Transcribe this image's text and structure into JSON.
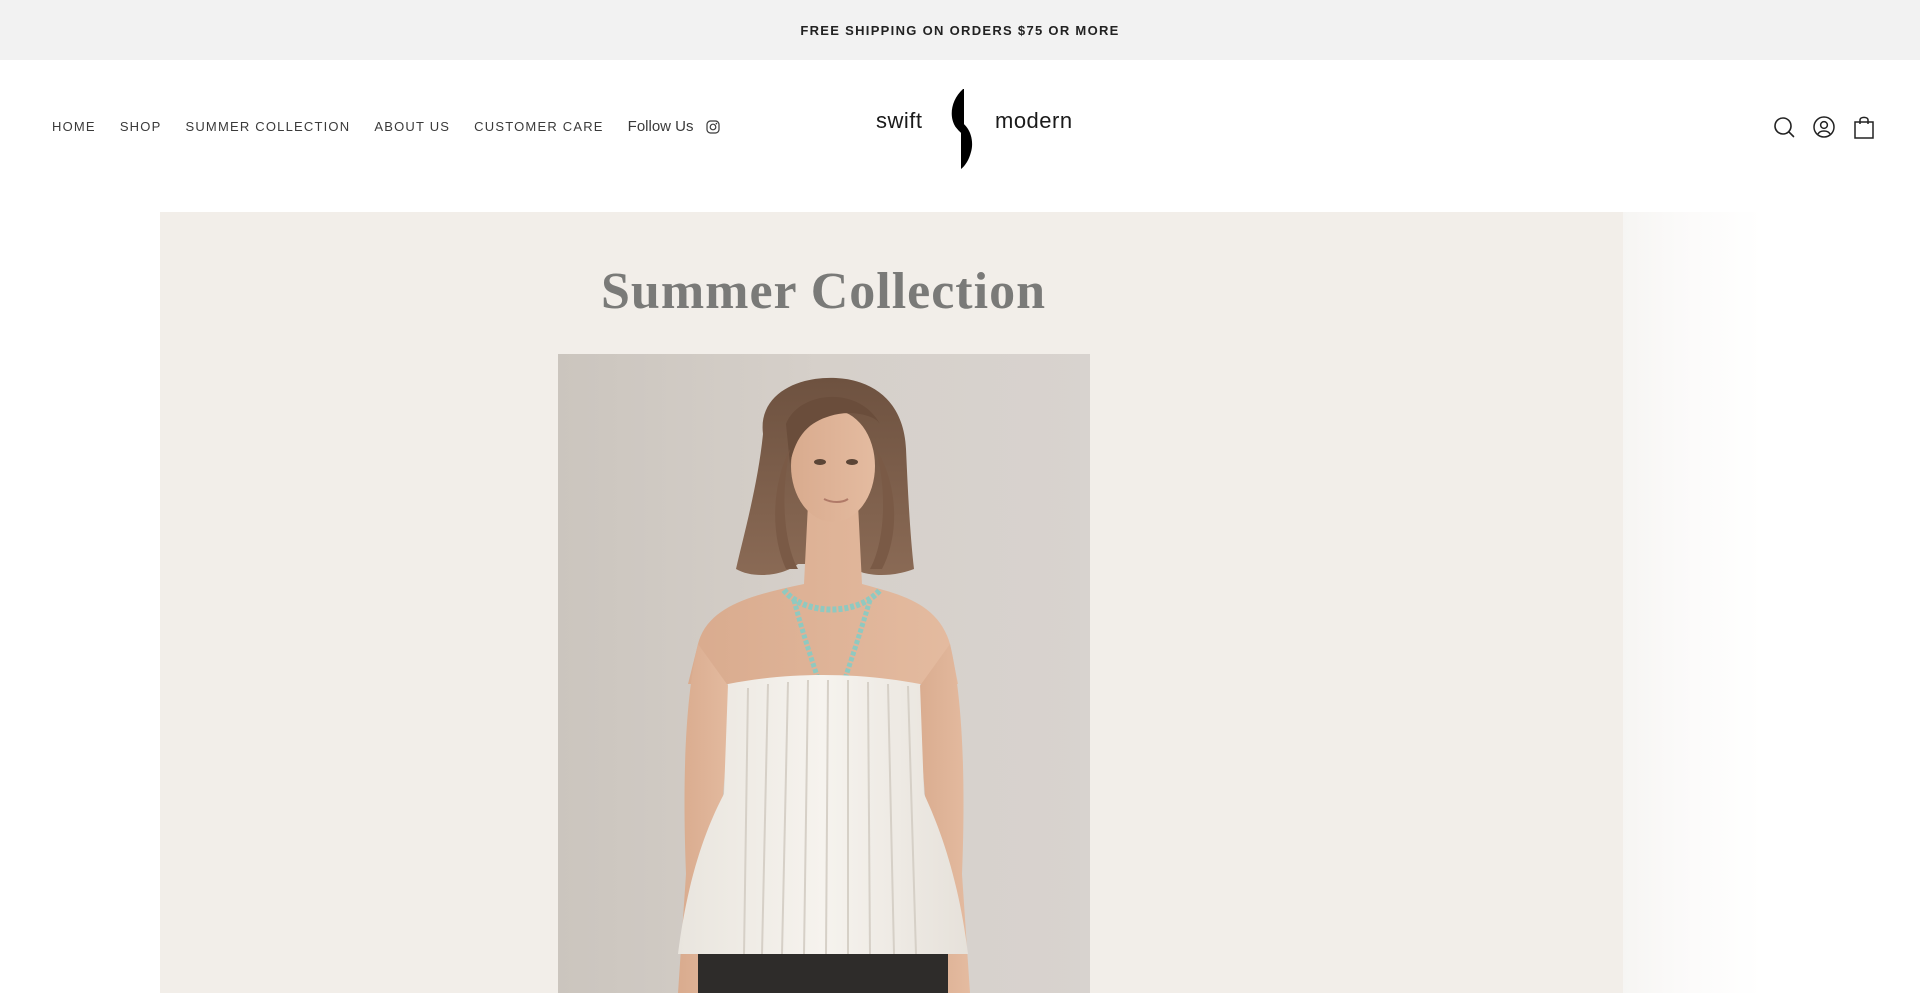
{
  "announcement": {
    "text": "FREE SHIPPING ON ORDERS $75 OR MORE"
  },
  "nav": {
    "items": [
      {
        "label": "HOME"
      },
      {
        "label": "SHOP"
      },
      {
        "label": "SUMMER COLLECTION"
      },
      {
        "label": "ABOUT US"
      },
      {
        "label": "CUSTOMER CARE"
      }
    ],
    "follow_label": "Follow Us",
    "follow_icon": "instagram-icon"
  },
  "logo": {
    "word_left": "swift",
    "word_right": "modern"
  },
  "header_icons": [
    "search-icon",
    "account-icon",
    "cart-icon"
  ],
  "hero": {
    "title": "Summer Collection",
    "image": "photo of a model wearing a white strapless pleated top and turquoise bead necklace"
  },
  "colors": {
    "announcement_bg": "#f2f2f2",
    "hero_bg": "#f2eee9",
    "title_color": "#7a7a78"
  }
}
